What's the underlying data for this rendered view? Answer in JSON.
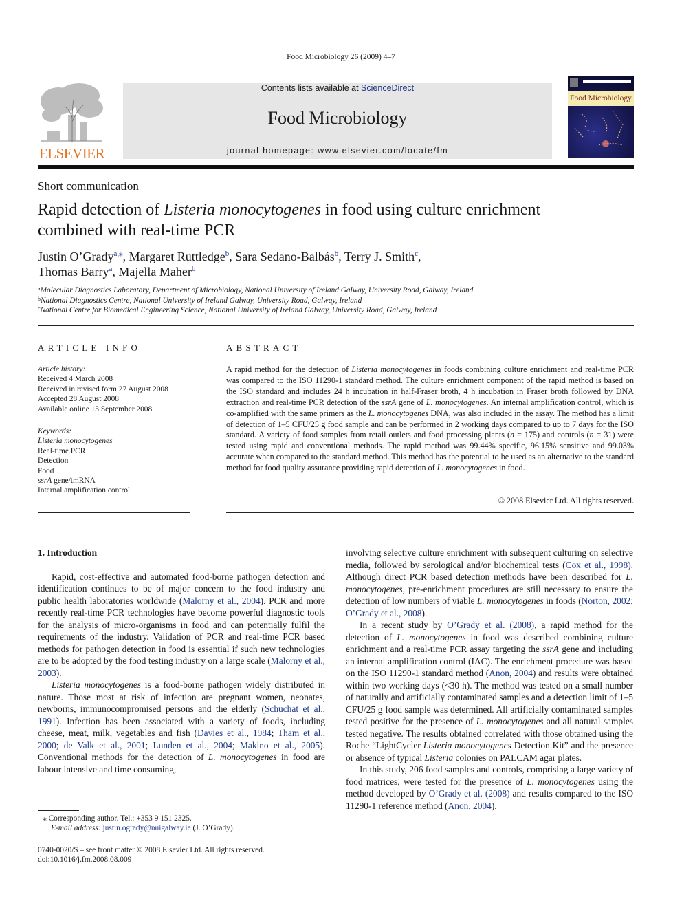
{
  "running_head": "Food Microbiology 26 (2009) 4–7",
  "masthead": {
    "publisher_logo_text": "ELSEVIER",
    "contents_prefix": "Contents lists available at ",
    "contents_link": "ScienceDirect",
    "journal_name": "Food Microbiology",
    "homepage": "journal homepage: www.elsevier.com/locate/fm",
    "cover_title": "Food Microbiology",
    "colors": {
      "publisher_orange": "#e8711d",
      "link_blue": "#1f3a8a",
      "banner_gray": "#e6e6e6"
    }
  },
  "article": {
    "type": "Short communication",
    "title_parts": [
      "Rapid detection of ",
      "Listeria monocytogenes",
      " in food using culture enrichment combined with real-time PCR"
    ],
    "authors": [
      {
        "name": "Justin O’Grady",
        "aff": "a,⁎",
        "sep": ", "
      },
      {
        "name": "Margaret Ruttledge",
        "aff": "b",
        "sep": ", "
      },
      {
        "name": "Sara Sedano-Balbás",
        "aff": "b",
        "sep": ", "
      },
      {
        "name": "Terry J. Smith",
        "aff": "c",
        "sep": ","
      },
      {
        "name": "Thomas Barry",
        "aff": "a",
        "sep": ", "
      },
      {
        "name": "Majella Maher",
        "aff": "b",
        "sep": ""
      }
    ],
    "affiliations": [
      {
        "key": "a",
        "text": "Molecular Diagnostics Laboratory, Department of Microbiology, National University of Ireland Galway, University Road, Galway, Ireland"
      },
      {
        "key": "b",
        "text": "National Diagnostics Centre, National University of Ireland Galway, University Road, Galway, Ireland"
      },
      {
        "key": "c",
        "text": "National Centre for Biomedical Engineering Science, National University of Ireland Galway, University Road, Galway, Ireland"
      }
    ]
  },
  "article_info": {
    "heading": "ARTICLE INFO",
    "history_label": "Article history:",
    "history": [
      "Received 4 March 2008",
      "Received in revised form 27 August 2008",
      "Accepted 28 August 2008",
      "Available online 13 September 2008"
    ],
    "keywords_label": "Keywords:",
    "keywords": [
      "Listeria monocytogenes",
      "Real-time PCR",
      "Detection",
      "Food",
      "ssrA gene/tmRNA",
      "Internal amplification control"
    ]
  },
  "abstract": {
    "heading": "ABSTRACT",
    "text": "A rapid method for the detection of Listeria monocytogenes in foods combining culture enrichment and real-time PCR was compared to the ISO 11290-1 standard method. The culture enrichment component of the rapid method is based on the ISO standard and includes 24 h incubation in half-Fraser broth, 4 h incubation in Fraser broth followed by DNA extraction and real-time PCR detection of the ssrA gene of L. monocytogenes. An internal amplification control, which is co-amplified with the same primers as the L. monocytogenes DNA, was also included in the assay. The method has a limit of detection of 1–5 CFU/25 g food sample and can be performed in 2 working days compared to up to 7 days for the ISO standard. A variety of food samples from retail outlets and food processing plants (n = 175) and controls (n = 31) were tested using rapid and conventional methods. The rapid method was 99.44% specific, 96.15% sensitive and 99.03% accurate when compared to the standard method. This method has the potential to be used as an alternative to the standard method for food quality assurance providing rapid detection of L. monocytogenes in food.",
    "copyright": "© 2008 Elsevier Ltd. All rights reserved."
  },
  "body": {
    "section_heading": "1.  Introduction",
    "left_paragraphs": [
      "Rapid, cost-effective and automated food-borne pathogen detection and identification continues to be of major concern to the food industry and public health laboratories worldwide (Malorny et al., 2004). PCR and more recently real-time PCR technologies have become powerful diagnostic tools for the analysis of micro-organisms in food and can potentially fulfil the requirements of the industry. Validation of PCR and real-time PCR based methods for pathogen detection in food is essential if such new technologies are to be adopted by the food testing industry on a large scale (Malorny et al., 2003).",
      "Listeria monocytogenes is a food-borne pathogen widely distributed in nature. Those most at risk of infection are pregnant women, neonates, newborns, immunocompromised persons and the elderly (Schuchat et al., 1991). Infection has been associated with a variety of foods, including cheese, meat, milk, vegetables and fish (Davies et al., 1984; Tham et al., 2000; de Valk et al., 2001; Lunden et al., 2004; Makino et al., 2005). Conventional methods for the detection of L. monocytogenes in food are labour intensive and time consuming,"
    ],
    "right_paragraphs": [
      "involving selective culture enrichment with subsequent culturing on selective media, followed by serological and/or biochemical tests (Cox et al., 1998). Although direct PCR based detection methods have been described for L. monocytogenes, pre-enrichment procedures are still necessary to ensure the detection of low numbers of viable L. monocytogenes in foods (Norton, 2002; O’Grady et al., 2008).",
      "In a recent study by O’Grady et al. (2008), a rapid method for the detection of L. monocytogenes in food was described combining culture enrichment and a real-time PCR assay targeting the ssrA gene and including an internal amplification control (IAC). The enrichment procedure was based on the ISO 11290-1 standard method (Anon, 2004) and results were obtained within two working days (<30 h). The method was tested on a small number of naturally and artificially contaminated samples and a detection limit of 1–5 CFU/25 g food sample was determined. All artificially contaminated samples tested positive for the presence of L. monocytogenes and all natural samples tested negative. The results obtained correlated with those obtained using the Roche “LightCycler Listeria monocytogenes Detection Kit” and the presence or absence of typical Listeria colonies on PALCAM agar plates.",
      "In this study, 206 food samples and controls, comprising a large variety of food matrices, were tested for the presence of L. monocytogenes using the method developed by O’Grady et al. (2008) and results compared to the ISO 11290-1 reference method (Anon, 2004)."
    ]
  },
  "footnote": {
    "marker": "⁎",
    "corresponding": "Corresponding author. Tel.: +353 9 151 2325.",
    "email_label": "E-mail address:",
    "email": "justin.ogrady@nuigalway.ie",
    "email_suffix": " (J. O’Grady)."
  },
  "front_matter": {
    "issn_line": "0740-0020/$ – see front matter © 2008 Elsevier Ltd. All rights reserved.",
    "doi": "doi:10.1016/j.fm.2008.08.009"
  }
}
